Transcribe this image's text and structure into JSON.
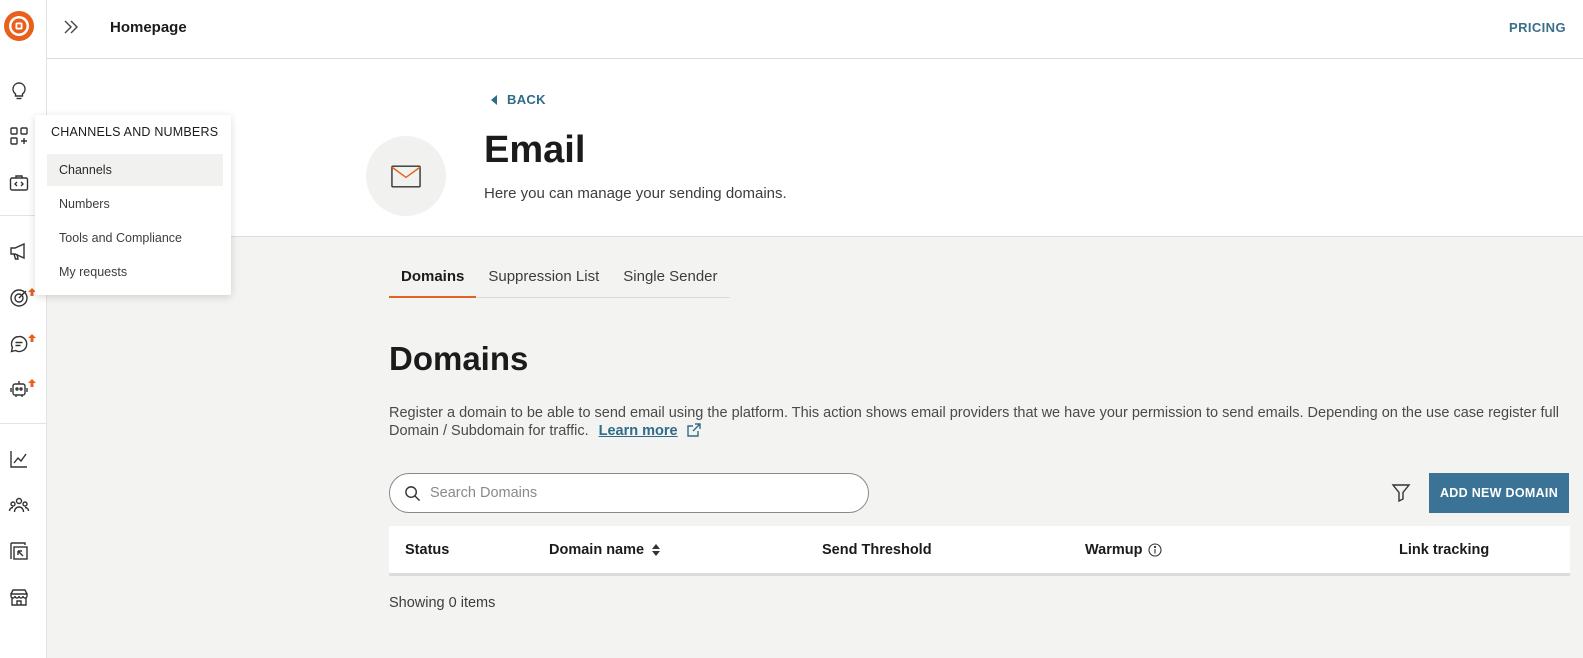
{
  "colors": {
    "brand_orange": "#e8601c",
    "accent_blue": "#3a7396",
    "link_blue": "#2f6b8a",
    "tab_active": "#e2641f"
  },
  "rail": {
    "icons": [
      "logo-icon",
      "lightbulb-icon",
      "apps-add-icon",
      "code-briefcase-icon",
      "megaphone-icon",
      "target-icon",
      "chat-icon",
      "robot-icon",
      "chart-line-icon",
      "people-icon",
      "gallery-icon",
      "store-icon"
    ],
    "upgrade_marker_icon": "arrow-up-icon"
  },
  "header": {
    "expand_icon": "double-chevron-right-icon",
    "breadcrumb": "Homepage",
    "pricing": "PRICING"
  },
  "flyout": {
    "title": "CHANNELS AND NUMBERS",
    "items": [
      {
        "label": "Channels",
        "active": true
      },
      {
        "label": "Numbers",
        "active": false
      },
      {
        "label": "Tools and Compliance",
        "active": false
      },
      {
        "label": "My requests",
        "active": false
      }
    ]
  },
  "hero": {
    "back": "BACK",
    "icon": "envelope-icon",
    "title": "Email",
    "subtitle": "Here you can manage your sending domains."
  },
  "tabs": [
    {
      "label": "Domains",
      "active": true
    },
    {
      "label": "Suppression List",
      "active": false
    },
    {
      "label": "Single Sender",
      "active": false
    }
  ],
  "domains": {
    "title": "Domains",
    "description": "Register a domain to be able to send email using the platform. This action shows email providers that we have your permission to send emails. Depending on the use case register full Domain / Subdomain for traffic.",
    "learn_more": "Learn more",
    "search_placeholder": "Search Domains",
    "search_value": "",
    "add_button": "ADD NEW DOMAIN",
    "columns": [
      "Status",
      "Domain name",
      "Send Threshold",
      "Warmup",
      "Link tracking"
    ],
    "showing": "Showing 0 items"
  }
}
